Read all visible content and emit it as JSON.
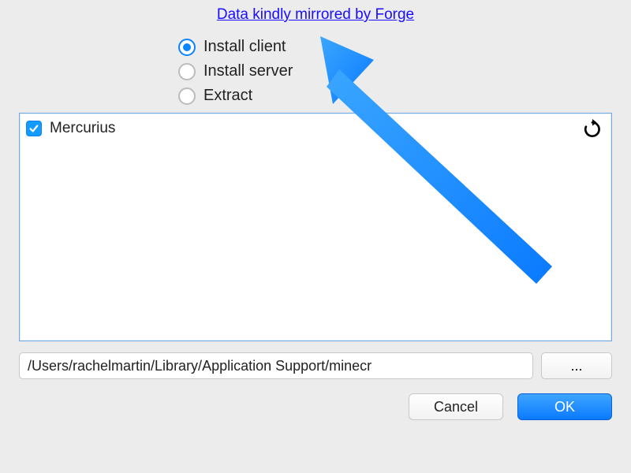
{
  "header": {
    "link_text": "Data kindly mirrored by Forge"
  },
  "options": {
    "items": [
      {
        "label": "Install client",
        "selected": true
      },
      {
        "label": "Install server",
        "selected": false
      },
      {
        "label": "Extract",
        "selected": false
      }
    ]
  },
  "components": {
    "items": [
      {
        "label": "Mercurius",
        "checked": true
      }
    ]
  },
  "path": {
    "value": "/Users/rachelmartin/Library/Application Support/minecr",
    "browse_label": "..."
  },
  "buttons": {
    "cancel": "Cancel",
    "ok": "OK"
  },
  "colors": {
    "accent": "#0a84ff",
    "arrow": "#1f90ff"
  }
}
